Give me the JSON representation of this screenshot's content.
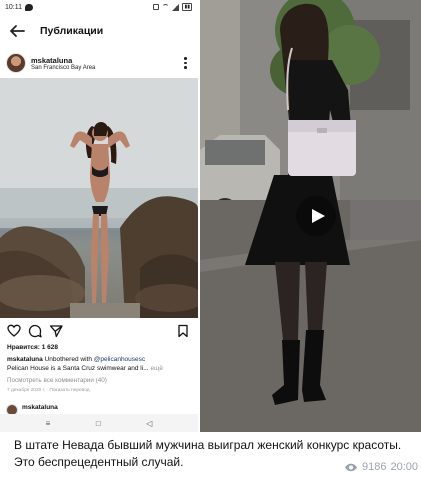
{
  "status_bar": {
    "time": "10:11"
  },
  "instagram": {
    "header_title": "Публикации",
    "username": "mskataluna",
    "location": "San Francisco Bay Area",
    "likes": "Нравится: 1 628",
    "caption_user": "mskataluna",
    "caption_text": "Unbothered with",
    "caption_mention": "@pelicanhousesc",
    "caption_line2": "Pelican House is a Santa Cruz swimwear and li...",
    "caption_more": "ещё",
    "comments_link": "Посмотреть все комментарии (40)",
    "post_date": "7 декабря 2020 г. · Показать перевод",
    "next_username": "mskataluna",
    "icons": [
      "back-arrow-icon",
      "more-vert-icon",
      "heart-icon",
      "comment-icon",
      "share-icon",
      "bookmark-icon"
    ]
  },
  "android_nav": {
    "menu": "≡",
    "home": "□",
    "back": "◁"
  },
  "message": {
    "text": "В штате Невада бывший мужчина выиграл женский конкурс красоты. Это беспрецедентный случай.",
    "views": "9186",
    "time": "20:00"
  },
  "colors": {
    "meta_gray": "#9aa3ad",
    "mention_blue": "#1c3a6b"
  }
}
